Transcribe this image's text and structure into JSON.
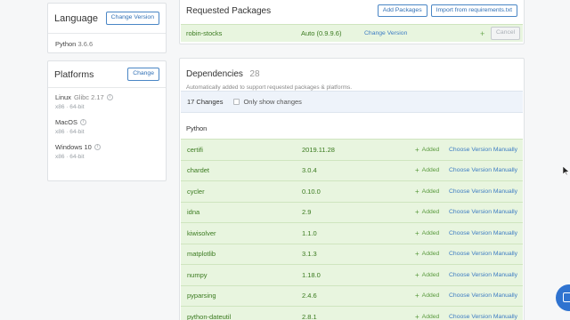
{
  "language": {
    "title": "Language",
    "change_label": "Change Version",
    "value_name": "Python",
    "value_version": "3.6.6"
  },
  "platforms": {
    "title": "Platforms",
    "change_label": "Change",
    "items": [
      {
        "name": "Linux",
        "detail": "Glibc 2.17",
        "arch": "x86 · 64-bit"
      },
      {
        "name": "MacOS",
        "detail": "",
        "arch": "x86 · 64-bit"
      },
      {
        "name": "Windows 10",
        "detail": "",
        "arch": "x86 · 64-bit"
      }
    ]
  },
  "requested": {
    "title": "Requested Packages",
    "add_label": "Add Packages",
    "import_label": "Import from requirements.txt",
    "row": {
      "name": "robin-stocks",
      "version": "Auto (0.9.9.6)",
      "change_label": "Change Version",
      "plus": "+",
      "cancel_label": "Cancel"
    }
  },
  "dependencies": {
    "title": "Dependencies",
    "count": "28",
    "subtitle": "Automatically added to support requested packages & platforms.",
    "changes_count": "17 Changes",
    "only_show_label": "Only show changes",
    "language_label": "Python",
    "added_label": "Added",
    "choose_label": "Choose Version Manually",
    "packages": [
      {
        "name": "certifi",
        "version": "2019.11.28"
      },
      {
        "name": "chardet",
        "version": "3.0.4"
      },
      {
        "name": "cycler",
        "version": "0.10.0"
      },
      {
        "name": "idna",
        "version": "2.9"
      },
      {
        "name": "kiwisolver",
        "version": "1.1.0"
      },
      {
        "name": "matplotlib",
        "version": "3.1.3"
      },
      {
        "name": "numpy",
        "version": "1.18.0"
      },
      {
        "name": "pyparsing",
        "version": "2.4.6"
      },
      {
        "name": "python-dateutil",
        "version": "2.8.1"
      }
    ]
  },
  "colors": {
    "accent": "#2f6fb5",
    "added_green": "#5a9a3e",
    "row_green": "#e8f5df"
  }
}
